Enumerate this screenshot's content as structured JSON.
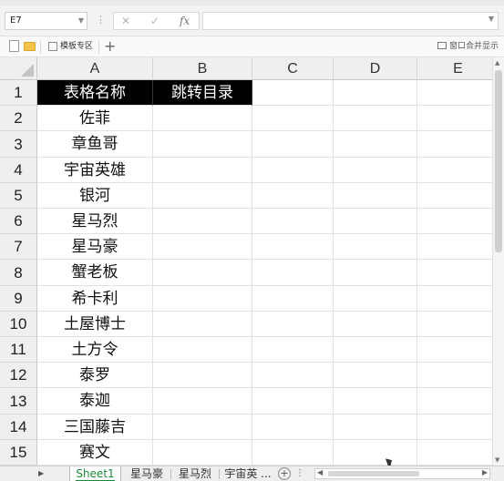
{
  "formula_bar": {
    "name_box": "E7",
    "cancel_icon": "✕",
    "confirm_icon": "✓",
    "fx_label": "fx",
    "formula_value": ""
  },
  "tab_strip": {
    "template_tab": "模板专区",
    "new_tab_icon": "+",
    "window_merge": "窗口合并显示"
  },
  "columns": [
    "A",
    "B",
    "C",
    "D",
    "E"
  ],
  "rows": [
    {
      "num": "1",
      "a": "表格名称",
      "b": "跳转目录"
    },
    {
      "num": "2",
      "a": "佐菲",
      "b": ""
    },
    {
      "num": "3",
      "a": "章鱼哥",
      "b": ""
    },
    {
      "num": "4",
      "a": "宇宙英雄",
      "b": ""
    },
    {
      "num": "5",
      "a": "银河",
      "b": ""
    },
    {
      "num": "6",
      "a": "星马烈",
      "b": ""
    },
    {
      "num": "7",
      "a": "星马豪",
      "b": ""
    },
    {
      "num": "8",
      "a": "蟹老板",
      "b": ""
    },
    {
      "num": "9",
      "a": "希卡利",
      "b": ""
    },
    {
      "num": "10",
      "a": "土屋博士",
      "b": ""
    },
    {
      "num": "11",
      "a": "土方令",
      "b": ""
    },
    {
      "num": "12",
      "a": "泰罗",
      "b": ""
    },
    {
      "num": "13",
      "a": "泰迦",
      "b": ""
    },
    {
      "num": "14",
      "a": "三国藤吉",
      "b": ""
    },
    {
      "num": "15",
      "a": "赛文",
      "b": ""
    }
  ],
  "sheets": {
    "tabs": [
      "Sheet1",
      "星马豪",
      "星马烈",
      "宇宙英 ..."
    ],
    "active": "Sheet1",
    "add_icon": "+",
    "more_icon": "⋮"
  },
  "colors": {
    "header_fill": "#000000",
    "header_text": "#ffffff",
    "active_sheet": "#1a8a3a"
  }
}
